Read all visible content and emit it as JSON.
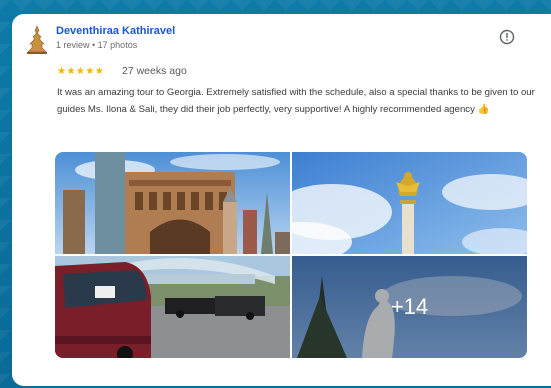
{
  "review": {
    "author_name": "Deventhiraa Kathiravel",
    "author_meta": "1 review • 17 photos",
    "stars": "★★★★★",
    "time_ago": "27 weeks ago",
    "text": "It was an amazing tour to Georgia. Extremely satisfied with the schedule, also a special thanks to be given to our guides Ms. Ilona & Sali, they did their job perfectly, very supportive! A highly recommended agency 👍",
    "rating": 5
  },
  "photos": {
    "more_count": "+14"
  },
  "icons": {
    "avatar": "temple-avatar-icon",
    "info": "report-info-icon"
  },
  "colors": {
    "background": "#0b6e9c",
    "name": "#1a57c9",
    "star": "#f6b400"
  }
}
